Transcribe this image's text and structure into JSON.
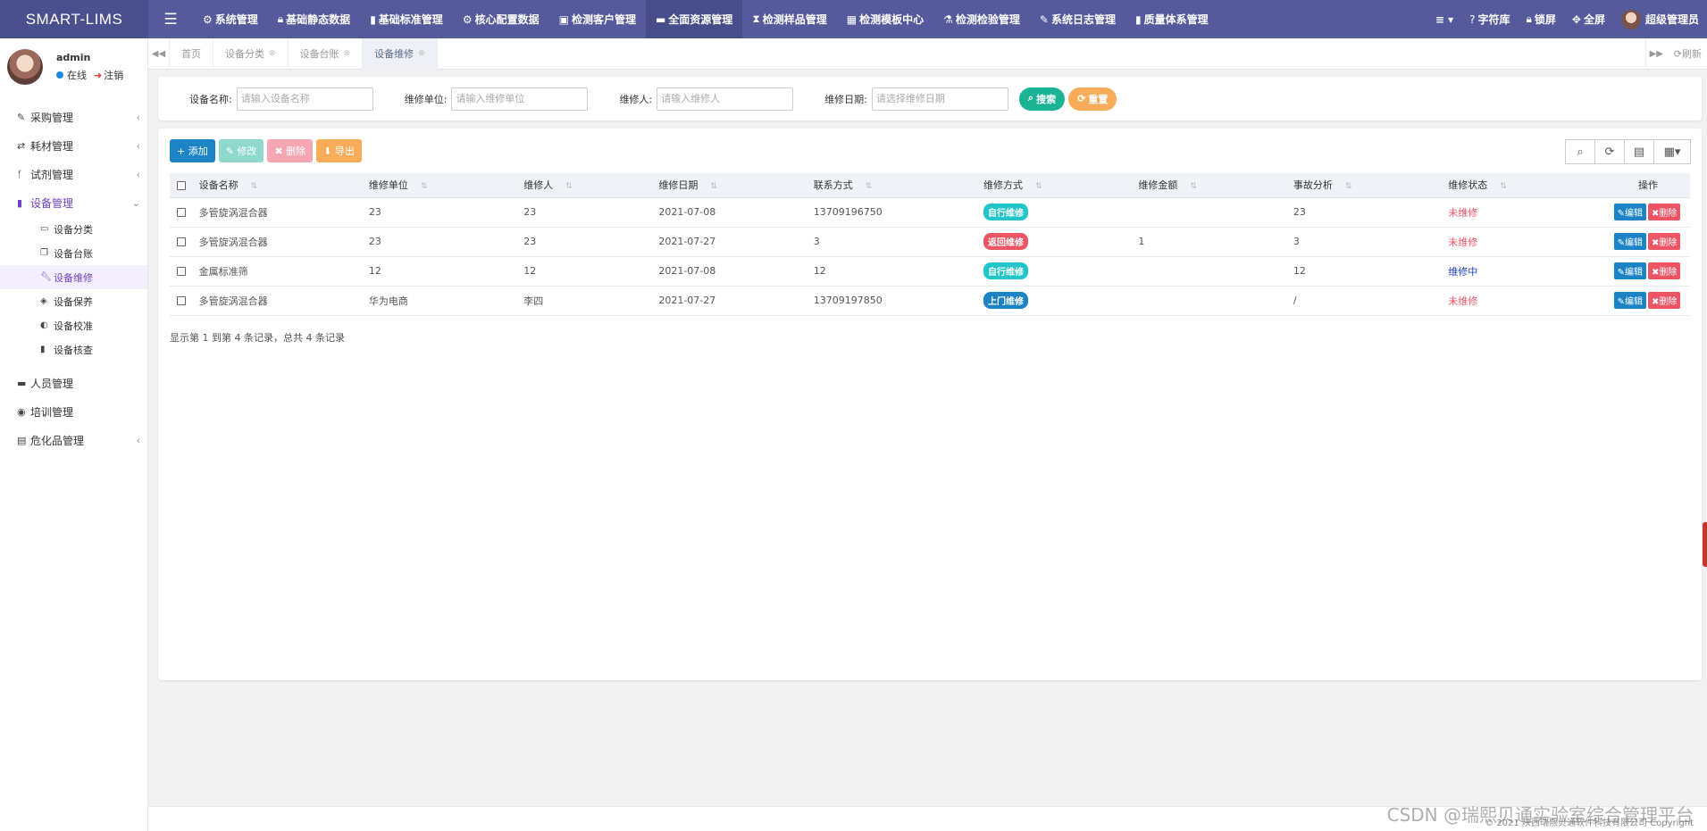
{
  "app": {
    "brand": "SMART-LIMS"
  },
  "topnav": [
    {
      "icon": "gear-icon",
      "glyph": "⚙",
      "label": "系统管理"
    },
    {
      "icon": "lock-icon",
      "glyph": "🔒︎",
      "label": "基础静态数据"
    },
    {
      "icon": "book-icon",
      "glyph": "▮",
      "label": "基础标准管理"
    },
    {
      "icon": "gear-icon",
      "glyph": "⚙",
      "label": "核心配置数据"
    },
    {
      "icon": "id-card-icon",
      "glyph": "▣",
      "label": "检测客户管理"
    },
    {
      "icon": "folder-icon",
      "glyph": "▬",
      "label": "全面资源管理"
    },
    {
      "icon": "hourglass-icon",
      "glyph": "⧗",
      "label": "检测样品管理"
    },
    {
      "icon": "calendar-icon",
      "glyph": "▦",
      "label": "检测模板中心"
    },
    {
      "icon": "flask-icon",
      "glyph": "⚗",
      "label": "检测检验管理"
    },
    {
      "icon": "edit-icon",
      "glyph": "✎",
      "label": "系统日志管理"
    },
    {
      "icon": "book-icon",
      "glyph": "▮",
      "label": "质量体系管理"
    }
  ],
  "topright": {
    "more_glyph": "≡ ▾",
    "font_lib": "字符库",
    "lock_screen": "锁屏",
    "fullscreen": "全屏",
    "user": "超级管理员"
  },
  "sidebar": {
    "username": "admin",
    "status": "在线",
    "logout": "注销",
    "menu": [
      {
        "label": "采购管理",
        "icon": "edit-icon",
        "glyph": "✎",
        "arrow": "‹"
      },
      {
        "label": "耗材管理",
        "icon": "exchange-icon",
        "glyph": "⇄",
        "arrow": "‹"
      },
      {
        "label": "试剂管理",
        "icon": "branch-icon",
        "glyph": "ᚶ",
        "arrow": "‹"
      },
      {
        "label": "设备管理",
        "icon": "book-icon",
        "glyph": "▮",
        "arrow": "⌄"
      }
    ],
    "submenu": [
      {
        "label": "设备分类",
        "icon": "laptop-icon",
        "glyph": "▭"
      },
      {
        "label": "设备台账",
        "icon": "clone-icon",
        "glyph": "❐"
      },
      {
        "label": "设备维修",
        "icon": "wrench-icon",
        "glyph": "🔧︎"
      },
      {
        "label": "设备保养",
        "icon": "tag-icon",
        "glyph": "◈"
      },
      {
        "label": "设备校准",
        "icon": "adjust-icon",
        "glyph": "◐"
      },
      {
        "label": "设备核查",
        "icon": "book-icon",
        "glyph": "▮"
      }
    ],
    "menu2": [
      {
        "label": "人员管理",
        "icon": "folder-open-icon",
        "glyph": "▬",
        "arrow": ""
      },
      {
        "label": "培训管理",
        "icon": "user-circle-icon",
        "glyph": "◉",
        "arrow": ""
      },
      {
        "label": "危化品管理",
        "icon": "file-icon",
        "glyph": "▤",
        "arrow": "‹"
      }
    ]
  },
  "tabs": [
    {
      "label": "首页",
      "closable": false
    },
    {
      "label": "设备分类",
      "closable": true
    },
    {
      "label": "设备台账",
      "closable": true
    },
    {
      "label": "设备维修",
      "closable": true
    }
  ],
  "tab_refresh": "刷新",
  "search": {
    "fields": [
      {
        "label": "设备名称:",
        "placeholder": "请输入设备名称"
      },
      {
        "label": "维修单位:",
        "placeholder": "请输入维修单位"
      },
      {
        "label": "维修人:",
        "placeholder": "请输入维修人"
      },
      {
        "label": "维修日期:",
        "placeholder": "请选择维修日期"
      }
    ],
    "search_btn": "搜索",
    "reset_btn": "重置"
  },
  "toolbar": {
    "add": "添加",
    "edit": "修改",
    "delete": "删除",
    "export": "导出"
  },
  "table": {
    "columns": [
      "设备名称",
      "维修单位",
      "维修人",
      "维修日期",
      "联系方式",
      "维修方式",
      "维修金额",
      "事故分析",
      "维修状态",
      "操作"
    ],
    "rows": [
      {
        "name": "多管旋涡混合器",
        "unit": "23",
        "person": "23",
        "date": "2021-07-08",
        "contact": "13709196750",
        "method": "自行维修",
        "method_color": "teal",
        "amount": "",
        "analysis": "23",
        "status": "未维修",
        "status_color": "red"
      },
      {
        "name": "多管旋涡混合器",
        "unit": "23",
        "person": "23",
        "date": "2021-07-27",
        "contact": "3",
        "method": "返回维修",
        "method_color": "red",
        "amount": "1",
        "analysis": "3",
        "status": "未维修",
        "status_color": "red"
      },
      {
        "name": "金属标准筛",
        "unit": "12",
        "person": "12",
        "date": "2021-07-08",
        "contact": "12",
        "method": "自行维修",
        "method_color": "teal",
        "amount": "",
        "analysis": "12",
        "status": "维修中",
        "status_color": "blue"
      },
      {
        "name": "多管旋涡混合器",
        "unit": "华为电商",
        "person": "李四",
        "date": "2021-07-27",
        "contact": "13709197850",
        "method": "上门维修",
        "method_color": "blue",
        "amount": "",
        "analysis": "/",
        "status": "未维修",
        "status_color": "red"
      }
    ],
    "edit_label": "编辑",
    "delete_label": "删除"
  },
  "pagination": {
    "info": "显示第 1 到第 4 条记录，总共 4 条记录"
  },
  "footer": {
    "copyright": "© 2021 陕西瑞熙贝通软件科技有限公司 Copyright"
  },
  "watermark": "CSDN @瑞熙贝通实验室综合管理平台",
  "colors": {
    "topbar": "#545a9c",
    "accent": "#6e42c1",
    "primary": "#1c84c6",
    "success": "#1ab394",
    "warning": "#f8ac59",
    "danger": "#ed5565",
    "info": "#23c6c8"
  }
}
